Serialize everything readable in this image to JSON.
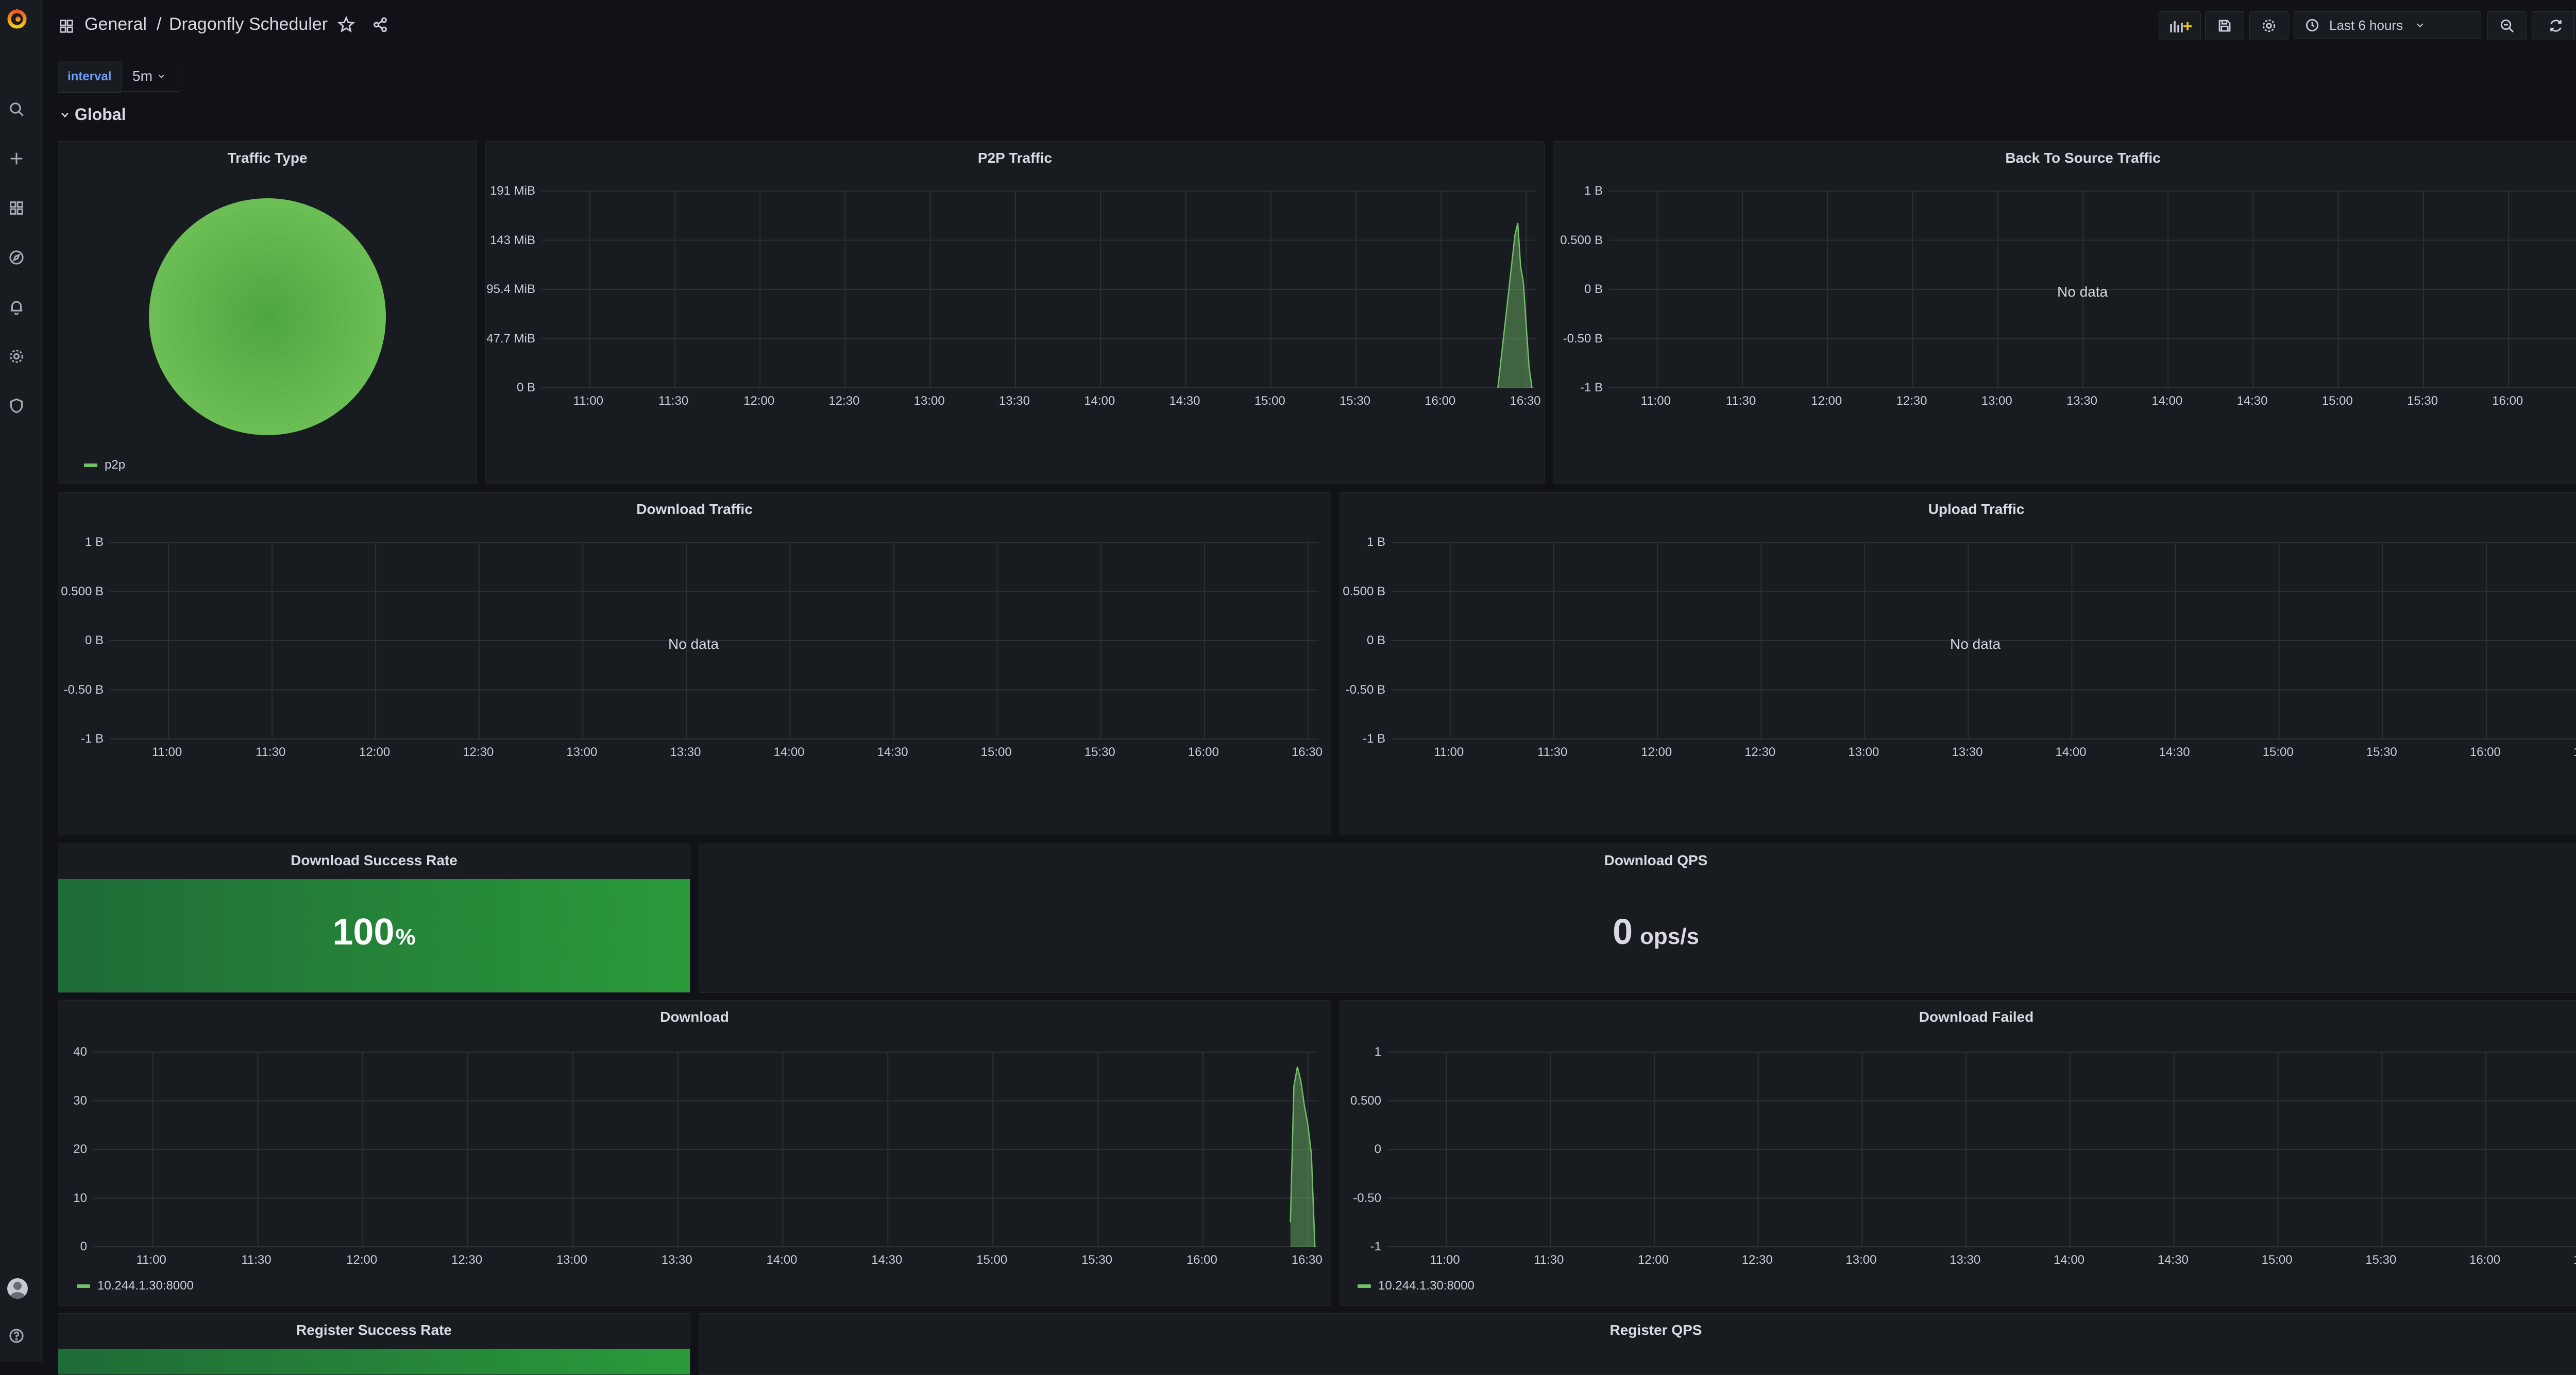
{
  "topbar": {
    "breadcrumb_folder": "General",
    "breadcrumb_sep": "/",
    "breadcrumb_dashboard": "Dragonfly Scheduler",
    "time_range": "Last 6 hours"
  },
  "variables": {
    "interval_label": "interval",
    "interval_value": "5m"
  },
  "row": {
    "title": "Global"
  },
  "colors": {
    "series_green": "#73bf69",
    "background": "#111217",
    "panel": "#181b1f"
  },
  "icons": [
    "grafana-logo-icon",
    "search-icon",
    "plus-icon",
    "dashboards-icon",
    "explore-icon",
    "alerting-icon",
    "gear-icon",
    "shield-icon",
    "avatar",
    "help-icon",
    "star-icon",
    "share-icon",
    "add-panel-icon",
    "save-icon",
    "settings-icon",
    "clock-icon",
    "zoom-out-icon",
    "refresh-icon",
    "tv-icon"
  ],
  "panels": {
    "traffic_type": {
      "title": "Traffic Type",
      "legend": "p2p"
    },
    "p2p_traffic": {
      "title": "P2P Traffic"
    },
    "back_to_source": {
      "title": "Back To Source Traffic",
      "nodata": "No data"
    },
    "download_traffic": {
      "title": "Download Traffic",
      "nodata": "No data"
    },
    "upload_traffic": {
      "title": "Upload Traffic",
      "nodata": "No data"
    },
    "download_success_rate": {
      "title": "Download Success Rate",
      "value": "100",
      "unit": "%"
    },
    "download_qps": {
      "title": "Download QPS",
      "value": "0",
      "unit": "ops/s"
    },
    "download": {
      "title": "Download",
      "legend": "10.244.1.30:8000"
    },
    "download_failed": {
      "title": "Download Failed",
      "legend": "10.244.1.30:8000"
    },
    "register_success_rate": {
      "title": "Register Success Rate"
    },
    "register_qps": {
      "title": "Register QPS"
    }
  },
  "chart_data": [
    {
      "panel": "traffic_type",
      "type": "pie",
      "title": "Traffic Type",
      "series": [
        {
          "name": "p2p",
          "values": [
            100
          ]
        }
      ]
    },
    {
      "panel": "p2p_traffic",
      "type": "area",
      "title": "P2P Traffic",
      "x_ticks": [
        "11:00",
        "11:30",
        "12:00",
        "12:30",
        "13:00",
        "13:30",
        "14:00",
        "14:30",
        "15:00",
        "15:30",
        "16:00",
        "16:30"
      ],
      "y_ticks": [
        "191 MiB",
        "143 MiB",
        "95.4 MiB",
        "47.7 MiB",
        "0 B"
      ],
      "ylim": [
        0,
        191
      ],
      "xlim": [
        "10:43",
        "16:33"
      ],
      "series": [
        {
          "x": [
            "16:20",
            "16:26",
            "16:27",
            "16:28",
            "16:29",
            "16:30",
            "16:31",
            "16:32"
          ],
          "y": [
            0,
            148,
            160,
            118,
            102,
            60,
            20,
            0
          ]
        }
      ]
    },
    {
      "panel": "back_to_source",
      "type": "line",
      "title": "Back To Source Traffic",
      "x_ticks": [
        "11:00",
        "11:30",
        "12:00",
        "12:30",
        "13:00",
        "13:30",
        "14:00",
        "14:30",
        "15:00",
        "15:30",
        "16:00",
        "16:30"
      ],
      "y_ticks": [
        "1 B",
        "0.500 B",
        "0 B",
        "-0.50 B",
        "-1 B"
      ],
      "series": []
    },
    {
      "panel": "download_traffic",
      "type": "line",
      "title": "Download Traffic",
      "x_ticks": [
        "11:00",
        "11:30",
        "12:00",
        "12:30",
        "13:00",
        "13:30",
        "14:00",
        "14:30",
        "15:00",
        "15:30",
        "16:00",
        "16:30"
      ],
      "y_ticks": [
        "1 B",
        "0.500 B",
        "0 B",
        "-0.50 B",
        "-1 B"
      ],
      "series": []
    },
    {
      "panel": "upload_traffic",
      "type": "line",
      "title": "Upload Traffic",
      "x_ticks": [
        "11:00",
        "11:30",
        "12:00",
        "12:30",
        "13:00",
        "13:30",
        "14:00",
        "14:30",
        "15:00",
        "15:30",
        "16:00",
        "16:30"
      ],
      "y_ticks": [
        "1 B",
        "0.500 B",
        "0 B",
        "-0.50 B",
        "-1 B"
      ],
      "series": []
    },
    {
      "panel": "download",
      "type": "area",
      "title": "Download",
      "x_ticks": [
        "11:00",
        "11:30",
        "12:00",
        "12:30",
        "13:00",
        "13:30",
        "14:00",
        "14:30",
        "15:00",
        "15:30",
        "16:00",
        "16:30"
      ],
      "y_ticks": [
        "40",
        "30",
        "20",
        "10",
        "0"
      ],
      "ylim": [
        0,
        40
      ],
      "xlim": [
        "10:43",
        "16:33"
      ],
      "series": [
        {
          "name": "10.244.1.30:8000",
          "x": [
            "16:25",
            "16:26",
            "16:27",
            "16:28",
            "16:29",
            "16:30",
            "16:31",
            "16:32"
          ],
          "y": [
            5,
            33,
            37,
            34,
            29,
            25,
            19,
            0
          ]
        }
      ]
    },
    {
      "panel": "download_failed",
      "type": "line",
      "title": "Download Failed",
      "x_ticks": [
        "11:00",
        "11:30",
        "12:00",
        "12:30",
        "13:00",
        "13:30",
        "14:00",
        "14:30",
        "15:00",
        "15:30",
        "16:00",
        "16:30"
      ],
      "y_ticks": [
        "1",
        "0.500",
        "0",
        "-0.50",
        "-1"
      ],
      "ylim": [
        -1,
        1
      ],
      "xlim": [
        "10:43",
        "16:33"
      ],
      "series": [
        {
          "name": "10.244.1.30:8000",
          "x": [
            "16:29",
            "16:33"
          ],
          "y": [
            0,
            0
          ]
        }
      ]
    }
  ]
}
